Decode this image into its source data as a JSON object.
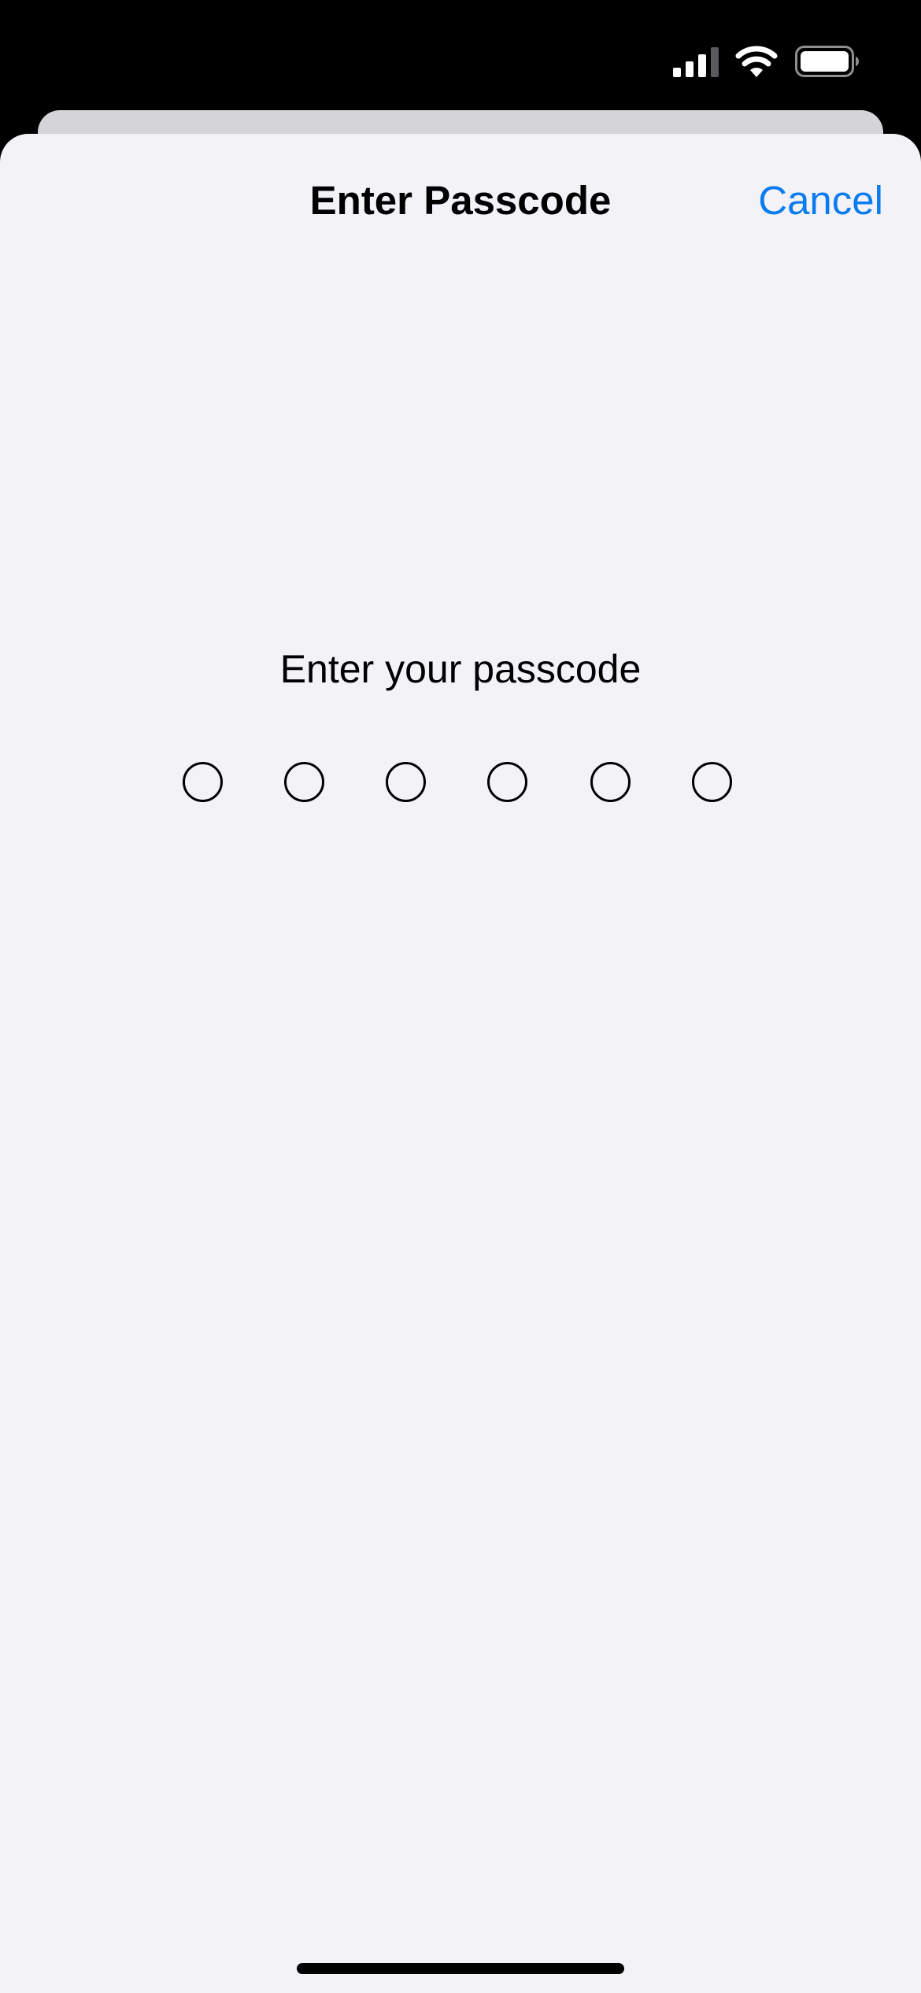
{
  "status_bar": {
    "icons": [
      "signal-icon",
      "wifi-icon",
      "battery-icon"
    ]
  },
  "sheet": {
    "title": "Enter Passcode",
    "cancel_label": "Cancel",
    "prompt": "Enter your passcode",
    "passcode_length": 6,
    "digits_entered": 0
  },
  "colors": {
    "accent": "#0a7cf0",
    "sheet_background": "#f2f2f7",
    "status_background": "#000000"
  }
}
